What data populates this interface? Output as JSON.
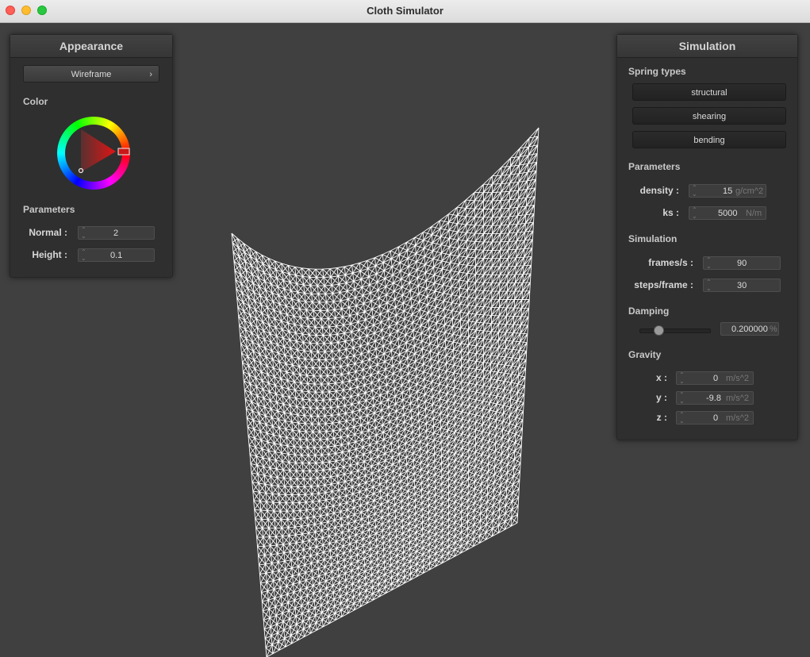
{
  "window": {
    "title": "Cloth Simulator"
  },
  "appearance": {
    "header": "Appearance",
    "shader": "Wireframe",
    "color_label": "Color",
    "selected_color": "#c81818",
    "params_label": "Parameters",
    "normal_label": "Normal :",
    "normal_value": "2",
    "height_label": "Height :",
    "height_value": "0.1"
  },
  "simulation": {
    "header": "Simulation",
    "spring_types_label": "Spring types",
    "spring_types": [
      "structural",
      "shearing",
      "bending"
    ],
    "params_label": "Parameters",
    "density_label": "density :",
    "density_value": "15",
    "density_unit": "g/cm^2",
    "ks_label": "ks :",
    "ks_value": "5000",
    "ks_unit": "N/m",
    "sim_label": "Simulation",
    "fps_label": "frames/s :",
    "fps_value": "90",
    "steps_label": "steps/frame :",
    "steps_value": "30",
    "damping_label": "Damping",
    "damping_value": "0.200000",
    "damping_unit": "%",
    "damping_level": 0.2,
    "gravity_label": "Gravity",
    "gx_label": "x :",
    "gx_value": "0",
    "gy_label": "y :",
    "gy_value": "-9.8",
    "gz_label": "z :",
    "gz_value": "0",
    "g_unit": "m/s^2"
  }
}
